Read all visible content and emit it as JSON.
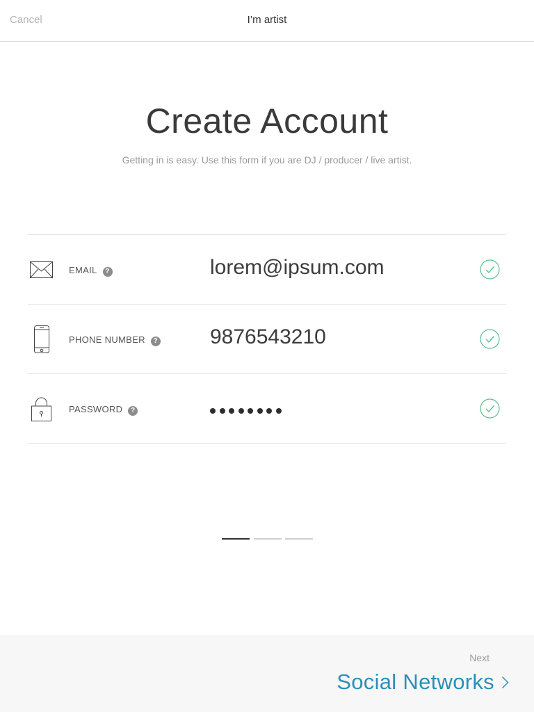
{
  "nav": {
    "cancel_label": "Cancel",
    "title": "I’m artist"
  },
  "page": {
    "title": "Create Account",
    "subtitle": "Getting in is easy. Use this form if you are DJ / producer / live artist."
  },
  "form": {
    "rows": [
      {
        "icon": "envelope-icon",
        "label": "EMAIL",
        "help": "?",
        "value": "lorem@ipsum.com",
        "status": "valid"
      },
      {
        "icon": "phone-icon",
        "label": "PHONE NUMBER",
        "help": "?",
        "value": "9876543210",
        "status": "valid"
      },
      {
        "icon": "lock-icon",
        "label": "PASSWORD",
        "help": "?",
        "value_masked_count": 8,
        "status": "valid"
      }
    ]
  },
  "pager": {
    "total": 3,
    "current": 1
  },
  "footer": {
    "next_label": "Next",
    "next_target": "Social Networks",
    "icon": "chevron-right-icon"
  },
  "colors": {
    "accent": "#2b8fb8",
    "check": "#5cc08f",
    "muted_text": "#9a9a9a",
    "divider": "#e3e3e3",
    "footer_bg": "#f7f7f7"
  }
}
